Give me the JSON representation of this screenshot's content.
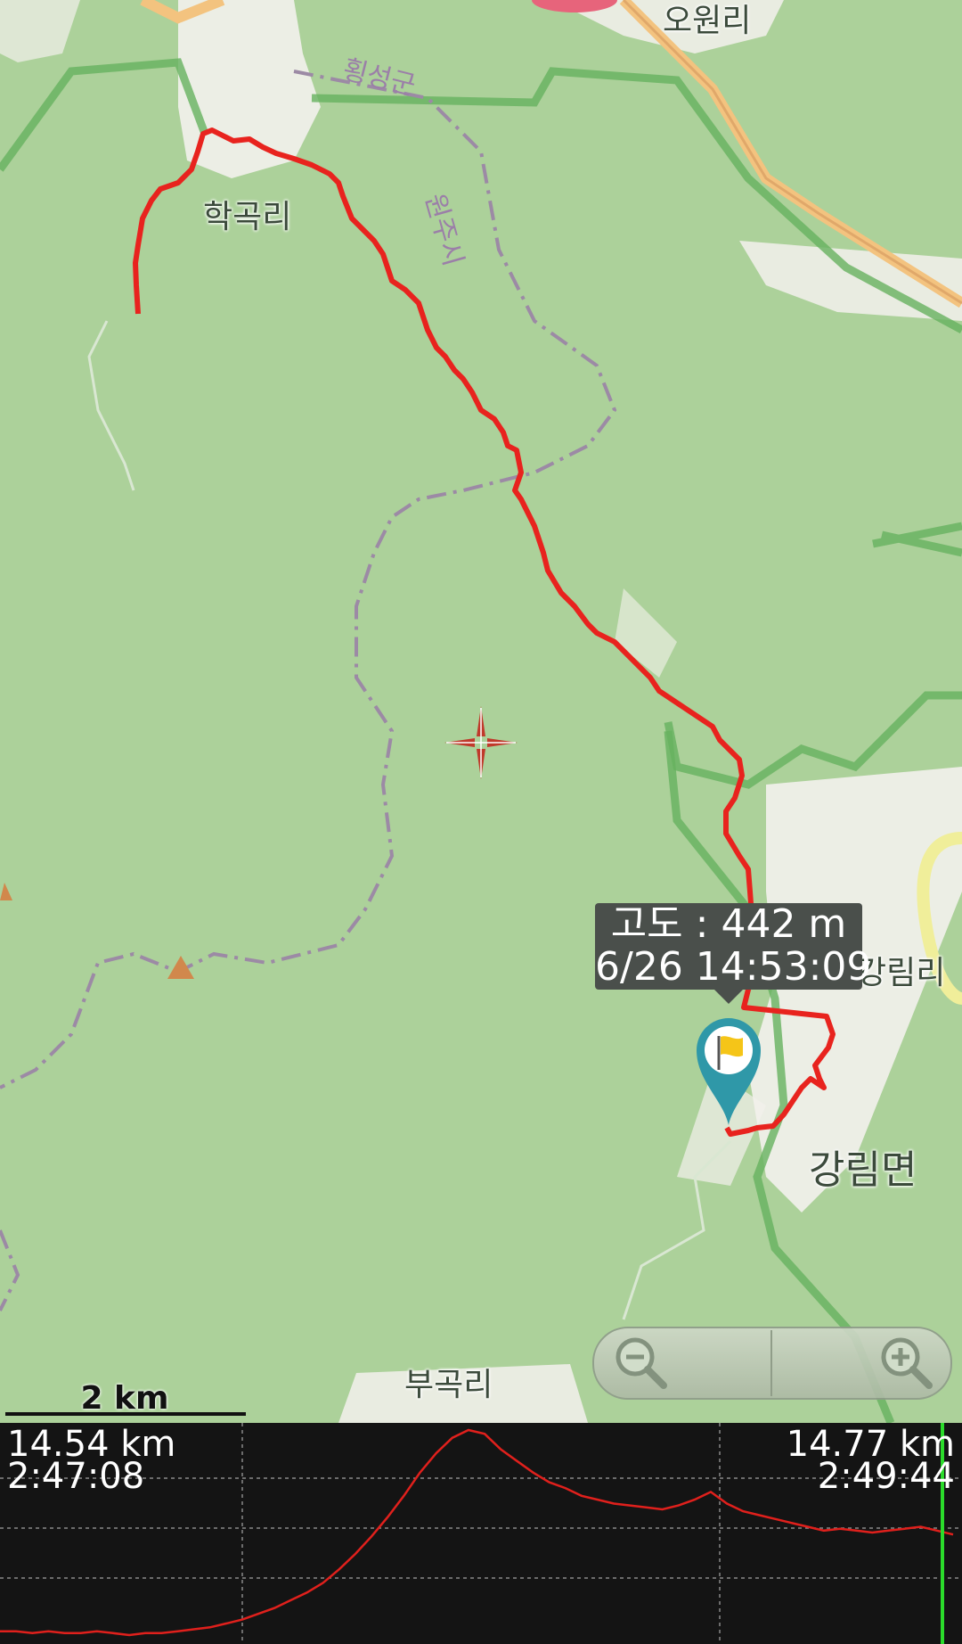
{
  "map": {
    "places": {
      "wonri": "오원리",
      "hoengseong": "횡성군",
      "hakgok": "학곡리",
      "wonju": "원주시",
      "gangnim_ri": "강림리",
      "gangnim_myeon": "강림면",
      "bugok": "부곡리"
    },
    "tooltip": {
      "altitude": "고도 : 442 m",
      "datetime": "6/26 14:53:09"
    },
    "scale_label": "2 km",
    "track_color": "#e8231e"
  },
  "graph": {
    "left_distance": "14.54 km",
    "left_time": "2:47:08",
    "right_distance": "14.77 km",
    "right_time": "2:49:44",
    "line_color": "#e0201c",
    "cursor_color": "#2bdc2b",
    "elevation_profile": [
      8,
      8,
      7,
      8,
      7,
      7,
      8,
      7,
      6,
      7,
      7,
      8,
      9,
      10,
      12,
      14,
      17,
      20,
      24,
      28,
      33,
      40,
      48,
      57,
      67,
      78,
      90,
      100,
      108,
      112,
      110,
      102,
      96,
      90,
      85,
      82,
      78,
      76,
      74,
      73,
      72,
      71,
      73,
      76,
      80,
      74,
      70,
      68,
      66,
      64,
      62,
      60,
      61,
      60,
      59,
      60,
      61,
      62,
      60,
      58
    ]
  }
}
